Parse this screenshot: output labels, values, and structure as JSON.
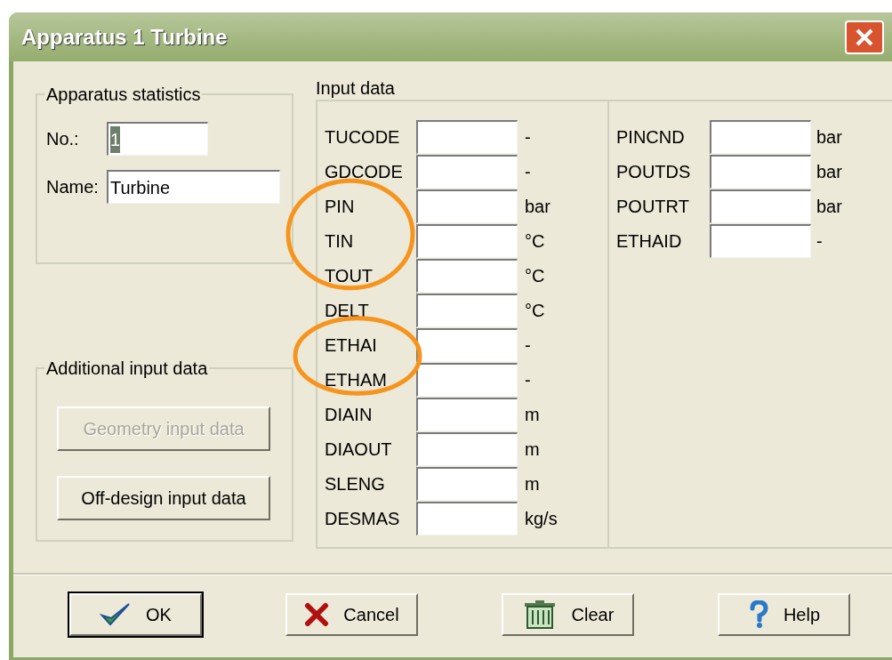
{
  "window": {
    "title": "Apparatus 1  Turbine"
  },
  "apparatus_statistics": {
    "title": "Apparatus statistics",
    "fields": [
      {
        "label": "No.:",
        "value": "1",
        "text_selected": true
      },
      {
        "label": "Name:",
        "value": "Turbine",
        "text_selected": false
      }
    ]
  },
  "additional_input_data": {
    "title": "Additional input data",
    "buttons": [
      {
        "label": "Geometry input data",
        "disabled": true
      },
      {
        "label": "Off-design input data",
        "disabled": false
      }
    ]
  },
  "input_data": {
    "title": "Input data",
    "left_rows": [
      {
        "label": "TUCODE",
        "unit": "-",
        "circled": false
      },
      {
        "label": "GDCODE",
        "unit": "-",
        "circled": false
      },
      {
        "label": "PIN",
        "unit": "bar",
        "circled": true
      },
      {
        "label": "TIN",
        "unit": "°C",
        "circled": true
      },
      {
        "label": "TOUT",
        "unit": "°C",
        "circled": true
      },
      {
        "label": "DELT",
        "unit": "°C",
        "circled": false
      },
      {
        "label": "ETHAI",
        "unit": "-",
        "circled": true
      },
      {
        "label": "ETHAM",
        "unit": "-",
        "circled": true
      },
      {
        "label": "DIAIN",
        "unit": "m",
        "circled": false
      },
      {
        "label": "DIAOUT",
        "unit": "m",
        "circled": false
      },
      {
        "label": "SLENG",
        "unit": "m",
        "circled": false
      },
      {
        "label": "DESMAS",
        "unit": "kg/s",
        "circled": false
      }
    ],
    "right_rows": [
      {
        "label": "PINCND",
        "unit": "bar"
      },
      {
        "label": "POUTDS",
        "unit": "bar"
      },
      {
        "label": "POUTRT",
        "unit": "bar"
      },
      {
        "label": "ETHAID",
        "unit": "-"
      }
    ]
  },
  "buttons": [
    {
      "kind": "ok",
      "label": "OK",
      "default": true
    },
    {
      "kind": "cancel",
      "label": "Cancel",
      "default": false
    },
    {
      "kind": "clear",
      "label": "Clear",
      "default": false
    },
    {
      "kind": "help",
      "label": "Help",
      "default": false
    }
  ]
}
